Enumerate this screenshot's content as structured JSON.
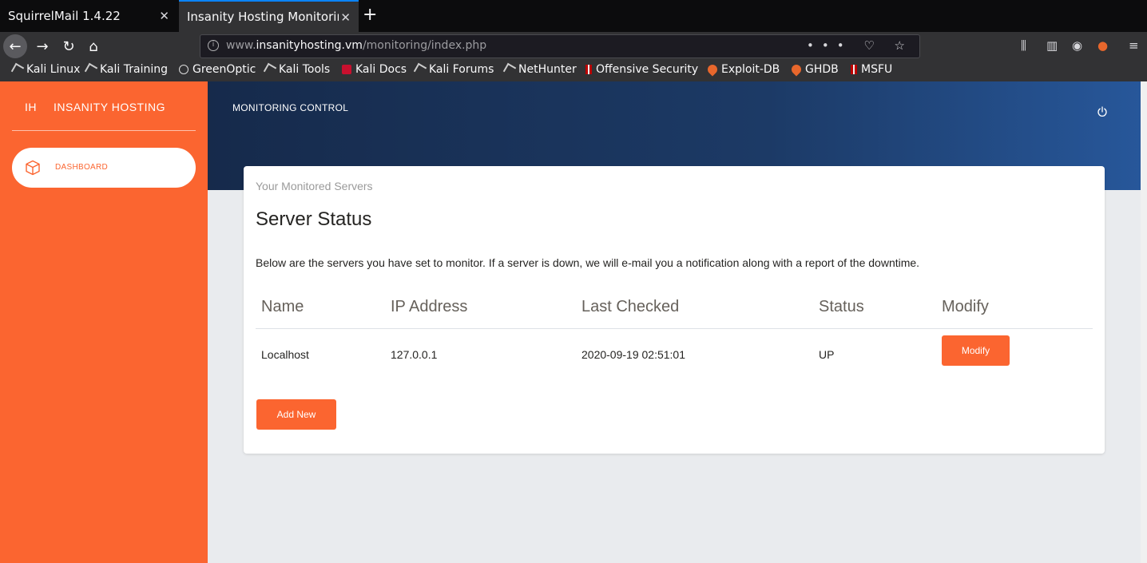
{
  "browser": {
    "tabs": [
      {
        "label": "SquirrelMail 1.4.22",
        "active": false
      },
      {
        "label": "Insanity Hosting Monitoring",
        "active": true
      }
    ],
    "new_tab_glyph": "+",
    "close_glyph": "✕",
    "url": {
      "prefix": "www.",
      "domain": "insanityhosting.vm",
      "path": "/monitoring/index.php"
    },
    "url_actions": "••• ♡ ☆",
    "bookmarks": [
      {
        "label": "Kali Linux",
        "icon": "kali-dragon-icon"
      },
      {
        "label": "Kali Training",
        "icon": "kali-dragon-icon"
      },
      {
        "label": "GreenOptic",
        "icon": "globe-icon"
      },
      {
        "label": "Kali Tools",
        "icon": "kali-dragon-icon"
      },
      {
        "label": "Kali Docs",
        "icon": "kali-docs-icon"
      },
      {
        "label": "Kali Forums",
        "icon": "kali-dragon-icon"
      },
      {
        "label": "NetHunter",
        "icon": "kali-dragon-icon"
      },
      {
        "label": "Offensive Security",
        "icon": "offsec-icon"
      },
      {
        "label": "Exploit-DB",
        "icon": "exploitdb-icon"
      },
      {
        "label": "GHDB",
        "icon": "exploitdb-icon"
      },
      {
        "label": "MSFU",
        "icon": "offsec-icon"
      }
    ]
  },
  "sidebar": {
    "logo_mini": "IH",
    "logo_text": "INSANITY HOSTING",
    "nav": [
      {
        "label": "DASHBOARD",
        "icon": "cube-icon",
        "active": true
      }
    ],
    "accent": "#fb6530"
  },
  "header": {
    "title": "MONITORING CONTROL",
    "logout_icon": "power-icon"
  },
  "card": {
    "category": "Your Monitored Servers",
    "title": "Server Status",
    "description": "Below are the servers you have set to monitor. If a server is down, we will e-mail you a notification along with a report of the downtime.",
    "table": {
      "headers": [
        "Name",
        "IP Address",
        "Last Checked",
        "Status",
        "Modify"
      ],
      "rows": [
        {
          "name": "Localhost",
          "ip": "127.0.0.1",
          "last_checked": "2020-09-19 02:51:01",
          "status": "UP",
          "action": "Modify"
        }
      ]
    },
    "add_button": "Add New"
  }
}
